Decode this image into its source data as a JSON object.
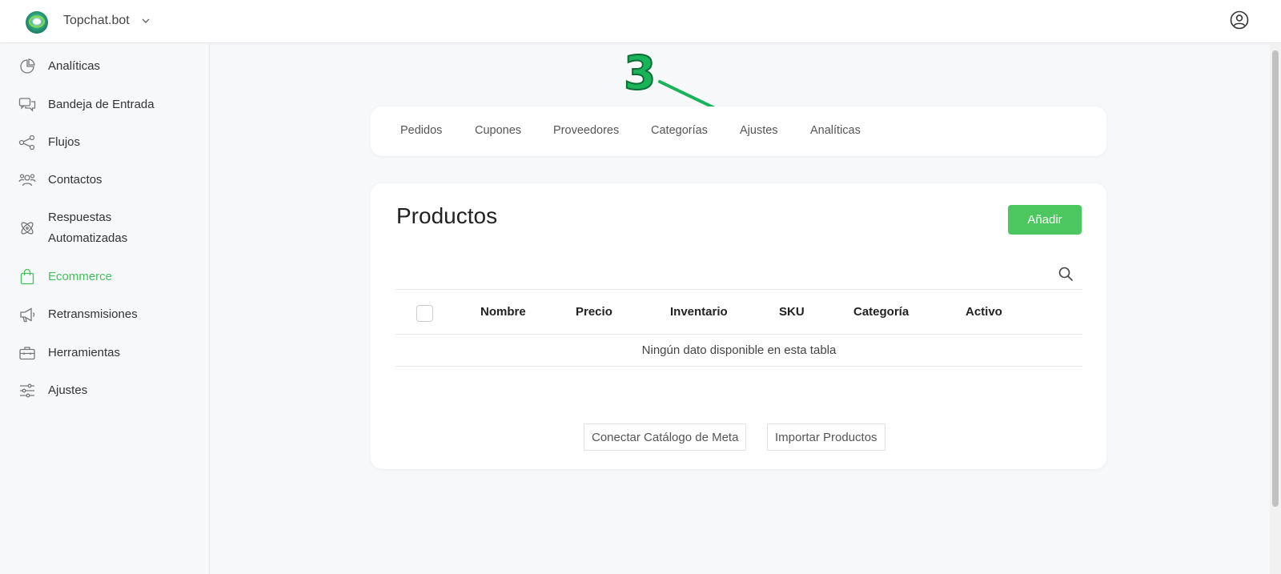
{
  "header": {
    "brand": "Topchat.bot",
    "logo_icon": "topchat-logo-icon",
    "user_icon": "user-circle-icon"
  },
  "sidebar": {
    "items": [
      {
        "label": "Analíticas",
        "icon": "pie-chart-icon",
        "active": false
      },
      {
        "label": "Bandeja de Entrada",
        "icon": "chat-bubbles-icon",
        "active": false
      },
      {
        "label": "Flujos",
        "icon": "share-nodes-icon",
        "active": false
      },
      {
        "label": "Contactos",
        "icon": "users-icon",
        "active": false
      },
      {
        "label": "Respuestas\nAutomatizadas",
        "icon": "atom-icon",
        "active": false
      },
      {
        "label": "Ecommerce",
        "icon": "shopping-bag-icon",
        "active": true
      },
      {
        "label": "Retransmisiones",
        "icon": "megaphone-icon",
        "active": false
      },
      {
        "label": "Herramientas",
        "icon": "toolbox-icon",
        "active": false
      },
      {
        "label": "Ajustes",
        "icon": "sliders-icon",
        "active": false
      }
    ]
  },
  "annotation": {
    "step": "3",
    "color": "#19b45a"
  },
  "tabs": [
    {
      "label": "Pedidos"
    },
    {
      "label": "Cupones"
    },
    {
      "label": "Proveedores"
    },
    {
      "label": "Categorías"
    },
    {
      "label": "Ajustes"
    },
    {
      "label": "Analíticas"
    }
  ],
  "products": {
    "title": "Productos",
    "add_label": "Añadir",
    "accent": "#4cc75f",
    "columns": [
      "Nombre",
      "Precio",
      "Inventario",
      "SKU",
      "Categoría",
      "Activo"
    ],
    "empty_text": "Ningún dato disponible en esta tabla",
    "connect_label": "Conectar Catálogo de Meta",
    "import_label": "Importar Productos"
  }
}
